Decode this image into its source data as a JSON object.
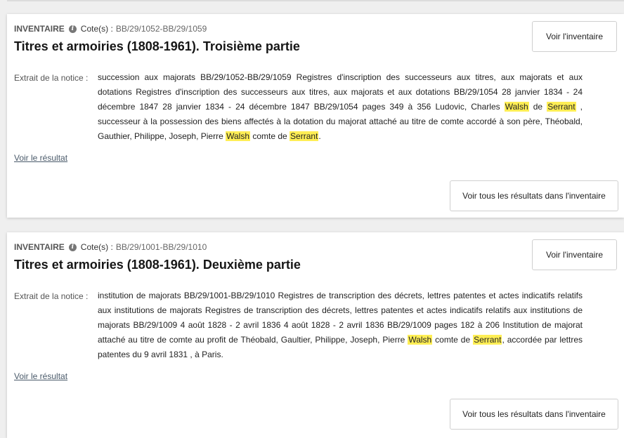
{
  "results": [
    {
      "type_label": "INVENTAIRE",
      "cote_label": "Cote(s) :",
      "cote_value": "BB/29/1052-BB/29/1059",
      "title": "Titres et armoiries (1808-1961). Troisième partie",
      "view_inventory_label": "Voir l'inventaire",
      "extract_label": "Extrait de la notice :",
      "extract_segments": [
        {
          "text": "succession aux majorats BB/29/1052-BB/29/1059 Registres d'inscription des successeurs aux titres, aux majorats et aux dotations Registres d'inscription des successeurs aux titres, aux majorats et aux dotations BB/29/1054 28 janvier 1834 - 24 décembre 1847 28 janvier 1834 - 24 décembre 1847 BB/29/1054 pages 349 à 356 Ludovic, Charles ",
          "hl": false
        },
        {
          "text": "Walsh",
          "hl": true
        },
        {
          "text": " de ",
          "hl": false
        },
        {
          "text": "Serrant",
          "hl": true
        },
        {
          "text": " , successeur à la possession des biens affectés à la dotation du majorat attaché au titre de comte accordé à son père, Théobald, Gauthier, Philippe, Joseph, Pierre ",
          "hl": false
        },
        {
          "text": "Walsh",
          "hl": true
        },
        {
          "text": " comte de ",
          "hl": false
        },
        {
          "text": "Serrant",
          "hl": true
        },
        {
          "text": ".",
          "hl": false
        }
      ],
      "result_link_label": "Voir le résultat",
      "all_results_label": "Voir tous les résultats dans l'inventaire"
    },
    {
      "type_label": "INVENTAIRE",
      "cote_label": "Cote(s) :",
      "cote_value": "BB/29/1001-BB/29/1010",
      "title": "Titres et armoiries (1808-1961). Deuxième partie",
      "view_inventory_label": "Voir l'inventaire",
      "extract_label": "Extrait de la notice :",
      "extract_segments": [
        {
          "text": "institution de majorats BB/29/1001-BB/29/1010 Registres de transcription des décrets, lettres patentes et actes indicatifs relatifs aux institutions de majorats Registres de transcription des décrets, lettres patentes et actes indicatifs relatifs aux institutions de majorats BB/29/1009 4 août 1828 - 2 avril 1836 4 août 1828 - 2 avril 1836 BB/29/1009 pages 182 à 206 Institution de majorat attaché au titre de comte au profit de Théobald, Gaultier, Philippe, Joseph, Pierre ",
          "hl": false
        },
        {
          "text": "Walsh",
          "hl": true
        },
        {
          "text": " comte de ",
          "hl": false
        },
        {
          "text": "Serrant",
          "hl": true
        },
        {
          "text": ", accordée par lettres patentes du 9 avril 1831 , à Paris.",
          "hl": false
        }
      ],
      "result_link_label": "Voir le résultat",
      "all_results_label": "Voir tous les résultats dans l'inventaire"
    }
  ],
  "colors": {
    "highlight": "#ffee55",
    "link": "#4a5a6a",
    "page_background": "#efefef"
  }
}
